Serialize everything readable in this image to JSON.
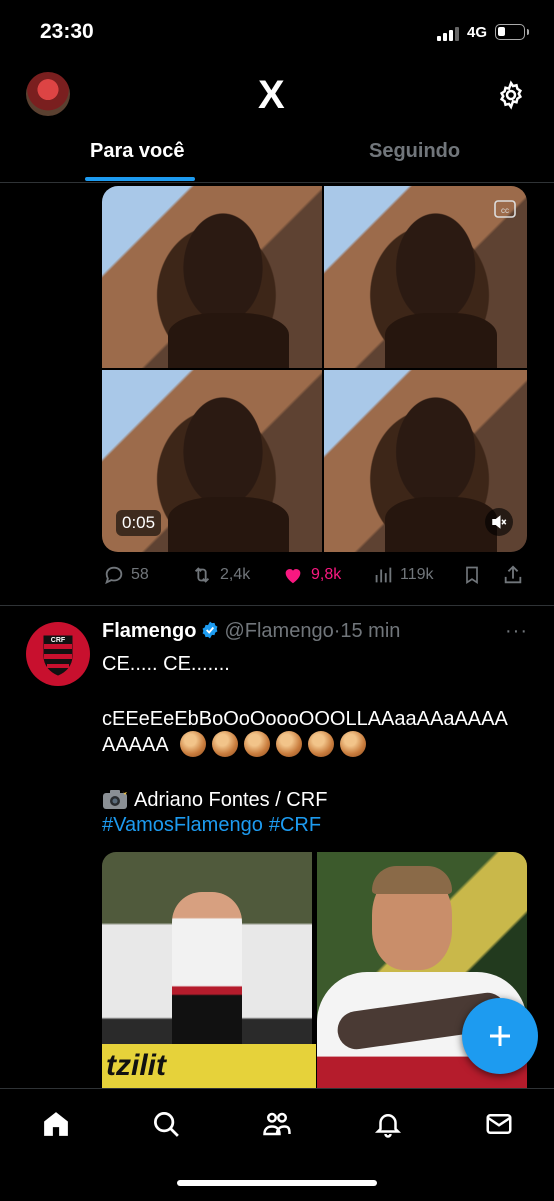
{
  "status_bar": {
    "time": "23:30",
    "network": "4G"
  },
  "header": {
    "logo": "X",
    "tabs": [
      {
        "label": "Para você",
        "active": true
      },
      {
        "label": "Seguindo",
        "active": false
      }
    ]
  },
  "video_post": {
    "timer": "0:05",
    "actions": {
      "replies": "58",
      "reposts": "2,4k",
      "likes": "9,8k",
      "views": "119k"
    }
  },
  "flamengo_post": {
    "name": "Flamengo",
    "handle": "@Flamengo",
    "separator": "·",
    "time": "15 min",
    "more": "···",
    "line1": "CE..... CE.......",
    "line2": "cEEeEeEbBoOoOoooOOOLLAAaaAAaAAAA",
    "line3": "AAAAA",
    "emoji_count": 6,
    "credit": "Adriano Fontes / CRF",
    "hashtags": [
      "#VamosFlamengo",
      "#CRF"
    ],
    "photo_ad_text": "tzilit"
  },
  "colors": {
    "accent": "#1d9bf0",
    "like": "#f91880",
    "muted": "#71767b",
    "flamengo_red": "#c8102e"
  },
  "icons": [
    "x-logo-icon",
    "gear-icon",
    "reply-icon",
    "repost-icon",
    "heart-icon",
    "views-icon",
    "bookmark-icon",
    "share-icon",
    "verified-icon",
    "home-icon",
    "search-icon",
    "communities-icon",
    "bell-icon",
    "mail-icon",
    "plus-icon"
  ]
}
